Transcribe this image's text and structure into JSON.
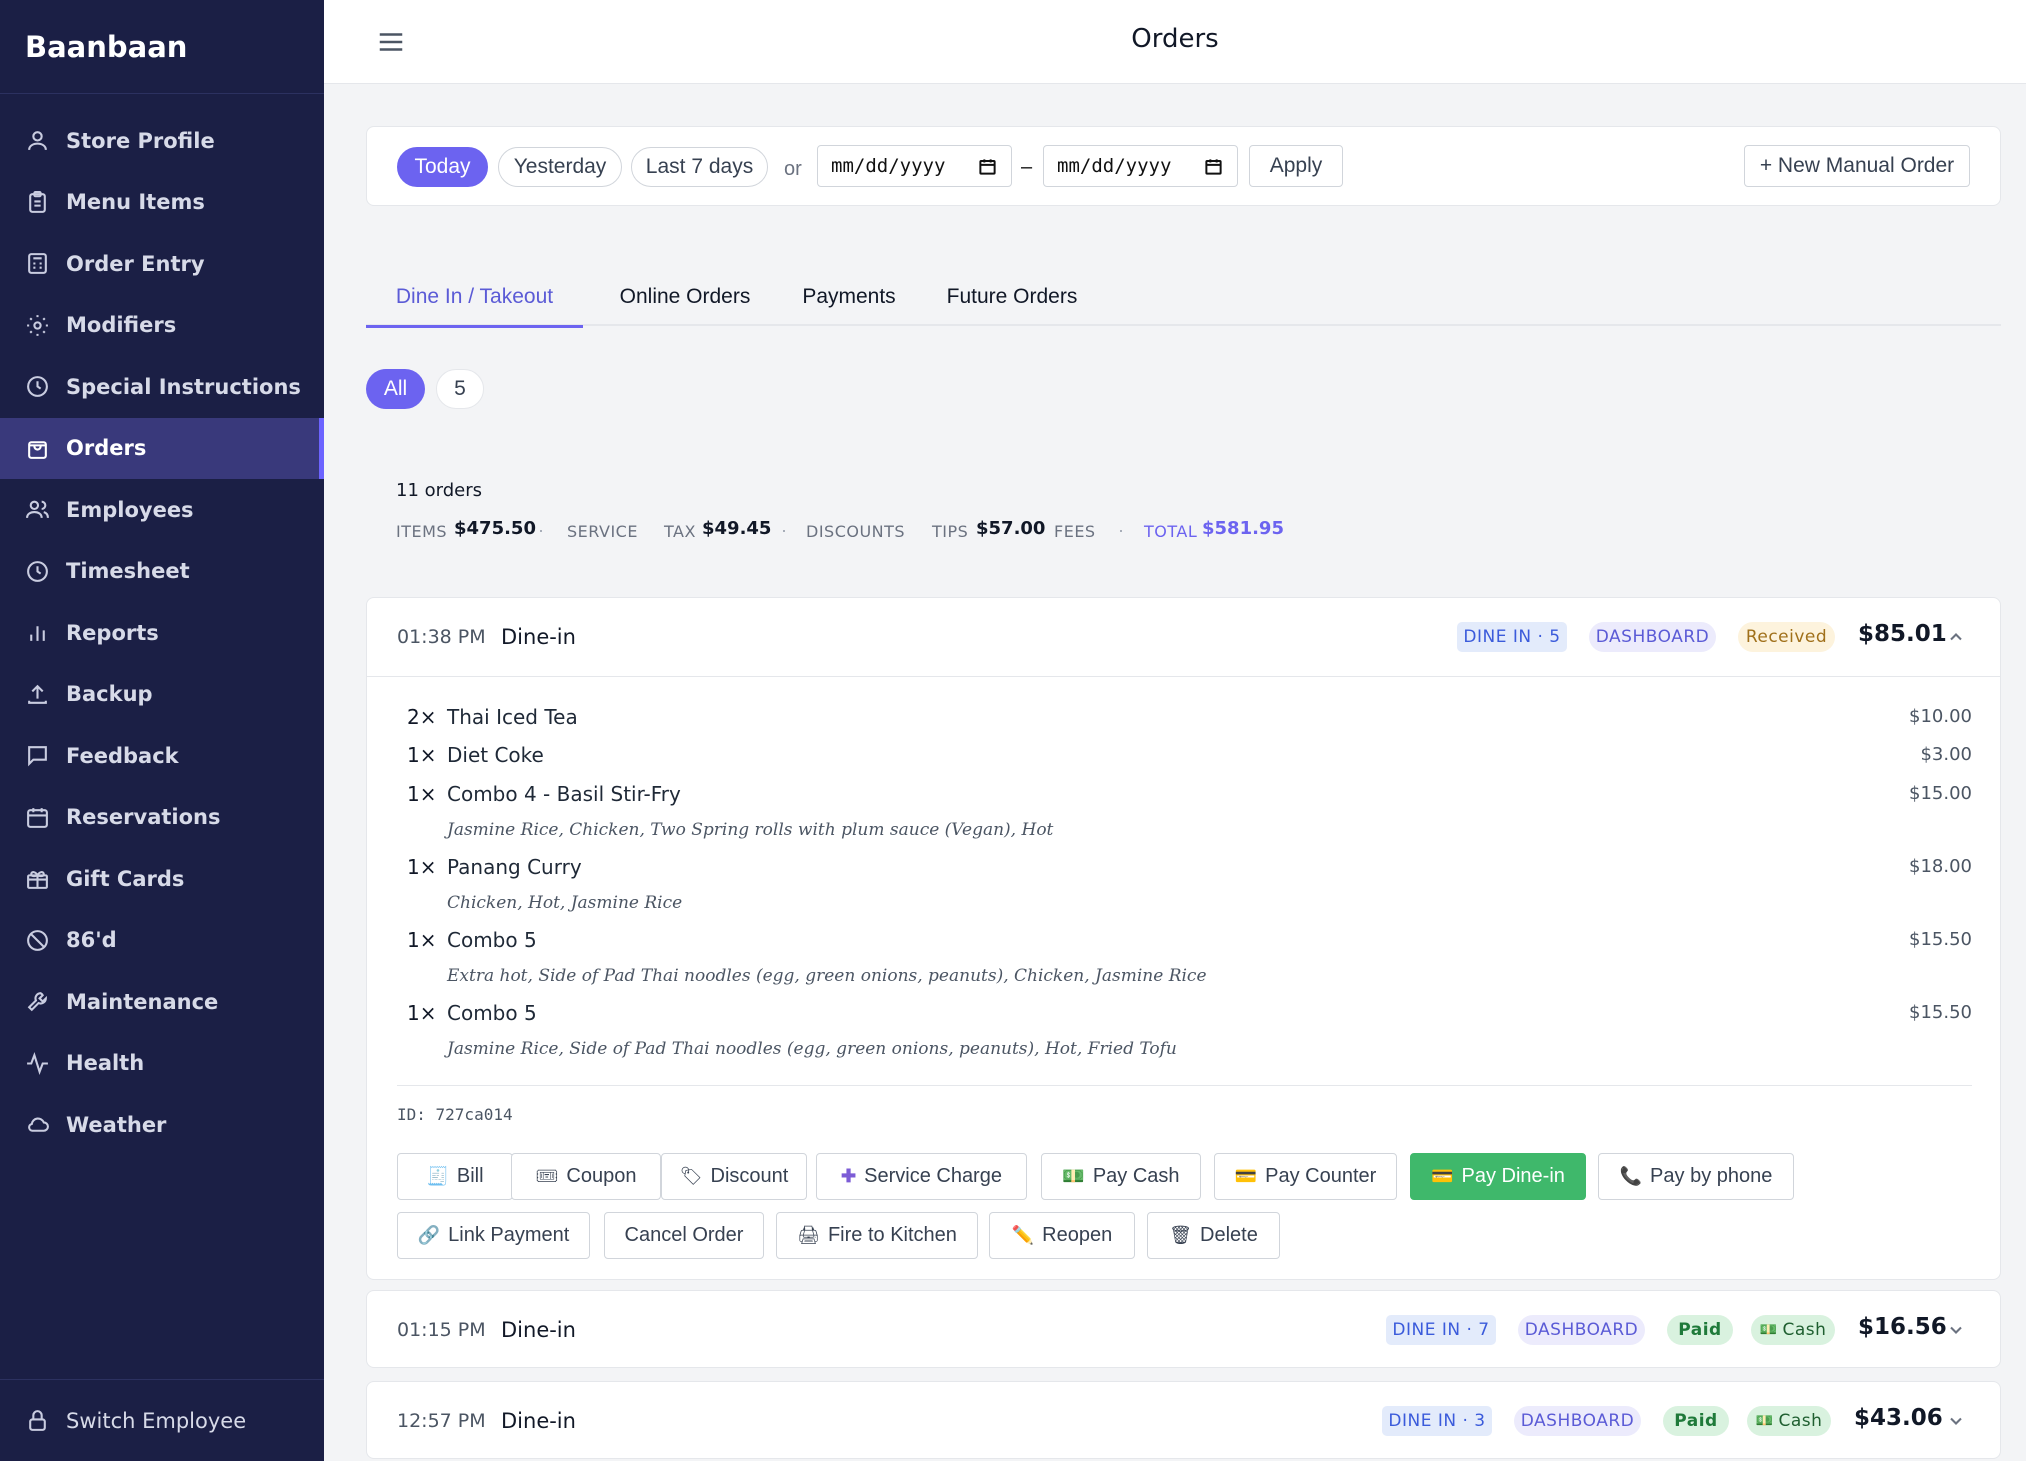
{
  "brand": "Baanbaan",
  "nav": [
    {
      "label": "Store Profile",
      "icon": "user-icon"
    },
    {
      "label": "Menu Items",
      "icon": "clipboard-icon"
    },
    {
      "label": "Order Entry",
      "icon": "calculator-icon"
    },
    {
      "label": "Modifiers",
      "icon": "sun-icon"
    },
    {
      "label": "Special Instructions",
      "icon": "clock-icon"
    },
    {
      "label": "Orders",
      "icon": "shopping-bag-icon"
    },
    {
      "label": "Employees",
      "icon": "users-icon"
    },
    {
      "label": "Timesheet",
      "icon": "clock-icon"
    },
    {
      "label": "Reports",
      "icon": "bar-chart-icon"
    },
    {
      "label": "Backup",
      "icon": "upload-icon"
    },
    {
      "label": "Feedback",
      "icon": "message-icon"
    },
    {
      "label": "Reservations",
      "icon": "calendar-icon"
    },
    {
      "label": "Gift Cards",
      "icon": "gift-icon"
    },
    {
      "label": "86'd",
      "icon": "prohibited-icon"
    },
    {
      "label": "Maintenance",
      "icon": "wrench-icon"
    },
    {
      "label": "Health",
      "icon": "activity-icon"
    },
    {
      "label": "Weather",
      "icon": "cloud-icon"
    }
  ],
  "active_nav": "Orders",
  "switch_employee": "Switch Employee",
  "header": {
    "title": "Orders"
  },
  "filters": {
    "today": "Today",
    "yesterday": "Yesterday",
    "last7": "Last 7 days",
    "or": "or",
    "date_from_placeholder": "mm/dd/yyyy",
    "dash": "–",
    "date_to_placeholder": "mm/dd/yyyy",
    "apply": "Apply",
    "new_order": "+ New Manual Order"
  },
  "tabs": [
    {
      "label": "Dine In / Takeout",
      "active": true
    },
    {
      "label": "Online Orders"
    },
    {
      "label": "Payments"
    },
    {
      "label": "Future Orders"
    }
  ],
  "table_filter": {
    "all": "All",
    "five": "5"
  },
  "summary": {
    "count": "11 orders",
    "items_label": "ITEMS",
    "items": "$475.50",
    "service_label": "SERVICE",
    "tax_label": "TAX",
    "tax": "$49.45",
    "discounts_label": "DISCOUNTS",
    "tips_label": "TIPS",
    "tips": "$57.00",
    "fees_label": "FEES",
    "total_label": "TOTAL",
    "total": "$581.95",
    "dot": "·"
  },
  "orders": [
    {
      "time": "01:38 PM",
      "type": "Dine-in",
      "table_badge": "DINE IN · 5",
      "source": "DASHBOARD",
      "status": "Received",
      "total": "$85.01",
      "expanded": true,
      "items": [
        {
          "qty": "2×",
          "name": "Thai Iced Tea",
          "price": "$10.00",
          "mods": ""
        },
        {
          "qty": "1×",
          "name": "Diet Coke",
          "price": "$3.00",
          "mods": ""
        },
        {
          "qty": "1×",
          "name": "Combo 4 - Basil Stir-Fry",
          "price": "$15.00",
          "mods": "Jasmine Rice, Chicken, Two Spring rolls with plum sauce (Vegan), Hot"
        },
        {
          "qty": "1×",
          "name": "Panang Curry",
          "price": "$18.00",
          "mods": "Chicken, Hot, Jasmine Rice"
        },
        {
          "qty": "1×",
          "name": "Combo 5",
          "price": "$15.50",
          "mods": "Extra hot, Side of Pad Thai noodles (egg, green onions, peanuts), Chicken, Jasmine Rice"
        },
        {
          "qty": "1×",
          "name": "Combo 5",
          "price": "$15.50",
          "mods": "Jasmine Rice, Side of Pad Thai noodles (egg, green onions, peanuts), Hot, Fried Tofu"
        }
      ],
      "id": "ID: 727ca014",
      "actions": {
        "bill": "Bill",
        "coupon": "Coupon",
        "discount": "Discount",
        "service_charge": "Service Charge",
        "pay_cash": "Pay Cash",
        "pay_counter": "Pay Counter",
        "pay_dinein": "Pay Dine-in",
        "pay_phone": "Pay by phone",
        "link_payment": "Link Payment",
        "cancel": "Cancel Order",
        "fire": "Fire to Kitchen",
        "reopen": "Reopen",
        "delete": "Delete"
      }
    },
    {
      "time": "01:15 PM",
      "type": "Dine-in",
      "table_badge": "DINE IN · 7",
      "source": "DASHBOARD",
      "status": "Paid",
      "method": "Cash",
      "total": "$16.56"
    },
    {
      "time": "12:57 PM",
      "type": "Dine-in",
      "table_badge": "DINE IN · 3",
      "source": "DASHBOARD",
      "status": "Paid",
      "method": "Cash",
      "total": "$43.06"
    }
  ],
  "colors": {
    "sidebar": "#1b1f45",
    "accent": "#6c63f0",
    "success": "#3fb86b"
  }
}
